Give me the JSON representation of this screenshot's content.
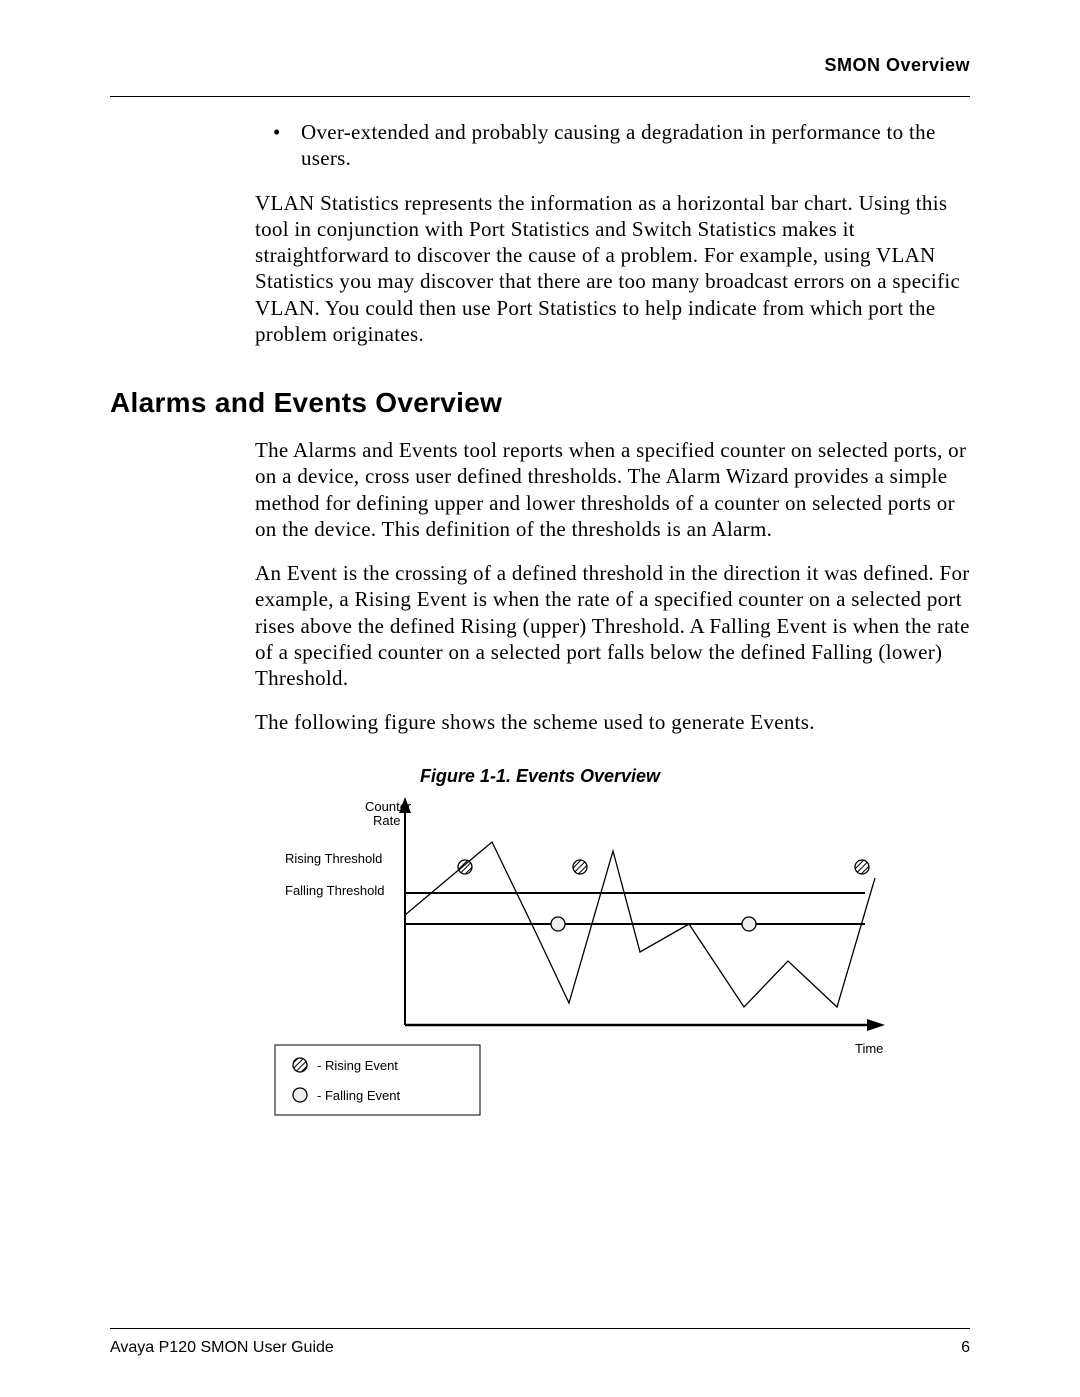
{
  "header": {
    "title": "SMON Overview"
  },
  "body": {
    "bullet1": "Over-extended and probably causing a degradation in performance to the users.",
    "para1": "VLAN Statistics represents the information as a horizontal bar chart. Using this tool in conjunction with Port Statistics and Switch Statistics makes it straightforward to discover the cause of a problem. For example, using VLAN Statistics you may discover that there are too many broadcast errors on a specific VLAN. You could then use Port Statistics to help indicate from which port the problem originates.",
    "section_heading": "Alarms and Events Overview",
    "para2": "The Alarms and Events tool reports when a specified counter on selected ports, or on a device, cross user defined thresholds. The Alarm Wizard provides a simple method for defining upper and lower thresholds of a counter on selected ports or on the device. This definition of the thresholds is an Alarm.",
    "para3": "An Event is the crossing of a defined threshold in the direction it was defined. For example, a Rising Event is when the rate of a specified counter on a selected port rises above the defined Rising (upper) Threshold. A Falling Event is when the rate of a specified counter on a selected port falls below the defined Falling (lower) Threshold.",
    "para4": "The following figure shows the scheme used to generate Events.",
    "figure_caption": "Figure 1-1.  Events Overview"
  },
  "figure_labels": {
    "y_axis_top": "Counter",
    "y_axis_top2": "Rate",
    "rising": "Rising Threshold",
    "falling": "Falling Threshold",
    "x_axis": "Time",
    "legend_rising": "- Rising Event",
    "legend_falling": "- Falling Event"
  },
  "footer": {
    "left": "Avaya P120 SMON User Guide",
    "right": "6"
  },
  "chart_data": {
    "type": "line",
    "title": "Events Overview",
    "xlabel": "Time",
    "ylabel": "Counter Rate",
    "thresholds": {
      "rising": 72,
      "falling": 55
    },
    "ylim": [
      0,
      120
    ],
    "xlim": [
      0,
      430
    ],
    "series": [
      {
        "name": "Counter Rate",
        "x": [
          0,
          40,
          80,
          120,
          150,
          190,
          215,
          260,
          310,
          350,
          395,
          430
        ],
        "y": [
          60,
          80,
          100,
          50,
          12,
          95,
          40,
          55,
          10,
          35,
          10,
          80
        ]
      }
    ],
    "events": {
      "rising": [
        {
          "x": 55,
          "y": 72
        },
        {
          "x": 160,
          "y": 72
        },
        {
          "x": 418,
          "y": 72
        }
      ],
      "falling": [
        {
          "x": 140,
          "y": 55
        },
        {
          "x": 315,
          "y": 55
        }
      ]
    },
    "legend": [
      "Rising Event",
      "Falling Event"
    ]
  }
}
